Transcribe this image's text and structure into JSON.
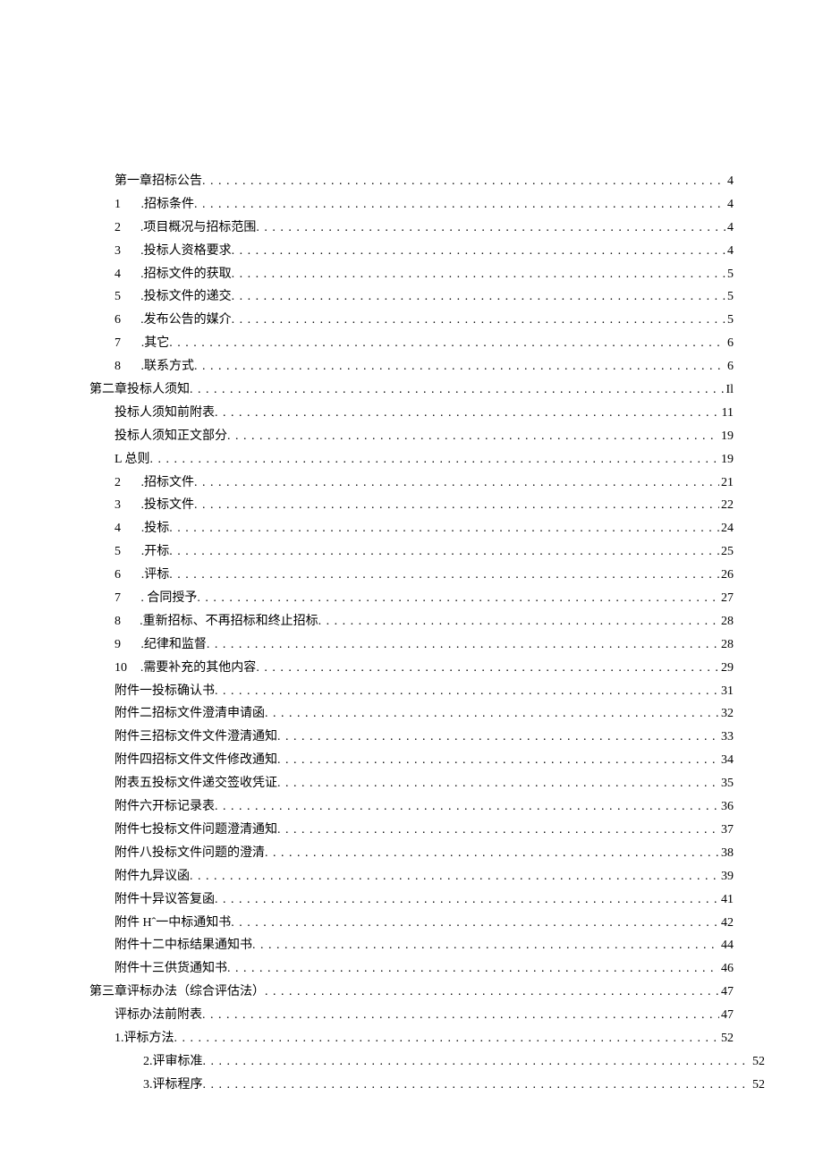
{
  "toc": [
    {
      "indent": 1,
      "num": "",
      "label": "第一章招标公告",
      "page": "4"
    },
    {
      "indent": 1,
      "num": "1",
      "label": ".招标条件",
      "page": "4"
    },
    {
      "indent": 1,
      "num": "2",
      "label": ".项目概况与招标范围",
      "page": "4"
    },
    {
      "indent": 1,
      "num": "3",
      "label": ".投标人资格要求",
      "page": "4"
    },
    {
      "indent": 1,
      "num": "4",
      "label": ".招标文件的获取",
      "page": "5"
    },
    {
      "indent": 1,
      "num": "5",
      "label": ".投标文件的递交",
      "page": "5"
    },
    {
      "indent": 1,
      "num": "6",
      "label": ".发布公告的媒介",
      "page": "5"
    },
    {
      "indent": 1,
      "num": "7",
      "label": ".其它",
      "page": "6"
    },
    {
      "indent": 1,
      "num": "8",
      "label": ".联系方式",
      "page": "6"
    },
    {
      "indent": 0,
      "num": "",
      "label": "第二章投标人须知",
      "page": "Il"
    },
    {
      "indent": 1,
      "num": "",
      "label": "投标人须知前附表",
      "page": "11"
    },
    {
      "indent": 1,
      "num": "",
      "label": "投标人须知正文部分",
      "page": "19"
    },
    {
      "indent": 1,
      "num": "",
      "label": "L 总则",
      "page": "19"
    },
    {
      "indent": 1,
      "num": "2",
      "label": ".招标文件",
      "page": "21"
    },
    {
      "indent": 1,
      "num": "3",
      "label": ".投标文件",
      "page": "22"
    },
    {
      "indent": 1,
      "num": "4",
      "label": ".投标",
      "page": "24"
    },
    {
      "indent": 1,
      "num": "5",
      "label": ".开标",
      "page": "25"
    },
    {
      "indent": 1,
      "num": "6",
      "label": ".评标",
      "page": "26"
    },
    {
      "indent": 1,
      "num": "7",
      "label": ". 合同授予",
      "page": "27"
    },
    {
      "indent": 1,
      "num": "8",
      "label": ".重新招标、不再招标和终止招标",
      "page": "28"
    },
    {
      "indent": 1,
      "num": "9",
      "label": ".纪律和监督",
      "page": "28"
    },
    {
      "indent": 1,
      "num": "10",
      "label": ".需要补充的其他内容",
      "page": "29"
    },
    {
      "indent": 1,
      "num": "",
      "label": "附件一投标确认书",
      "page": "31"
    },
    {
      "indent": 1,
      "num": "",
      "label": "附件二招标文件澄清申请函",
      "page": "32"
    },
    {
      "indent": 1,
      "num": "",
      "label": "附件三招标文件文件澄清通知",
      "page": "33"
    },
    {
      "indent": 1,
      "num": "",
      "label": "附件四招标文件文件修改通知",
      "page": "34"
    },
    {
      "indent": 1,
      "num": "",
      "label": "附表五投标文件递交签收凭证",
      "page": "35"
    },
    {
      "indent": 1,
      "num": "",
      "label": "附件六开标记录表",
      "page": "36"
    },
    {
      "indent": 1,
      "num": "",
      "label": "附件七投标文件问题澄清通知",
      "page": "37"
    },
    {
      "indent": 1,
      "num": "",
      "label": "附件八投标文件问题的澄清",
      "page": "38"
    },
    {
      "indent": 1,
      "num": "",
      "label": "附件九异议函",
      "page": "39"
    },
    {
      "indent": 1,
      "num": "",
      "label": "附件十异议答复函",
      "page": "41"
    },
    {
      "indent": 1,
      "num": "",
      "label": "附件 Hˆ一中标通知书",
      "page": "42"
    },
    {
      "indent": 1,
      "num": "",
      "label": "附件十二中标结果通知书",
      "page": "44"
    },
    {
      "indent": 1,
      "num": "",
      "label": "附件十三供货通知书",
      "page": "46"
    },
    {
      "indent": 0,
      "num": "",
      "label": "第三章评标办法（综合评估法）",
      "page": "47"
    },
    {
      "indent": 1,
      "num": "",
      "label": "评标办法前附表",
      "page": "47"
    },
    {
      "indent": 1,
      "num": "",
      "label": "1.评标方法",
      "page": "52"
    },
    {
      "indent": 2,
      "num": "",
      "label": "2.评审标准",
      "page": "52",
      "wide": true
    },
    {
      "indent": 2,
      "num": "",
      "label": "3.评标程序",
      "page": "52",
      "wide": true
    }
  ]
}
